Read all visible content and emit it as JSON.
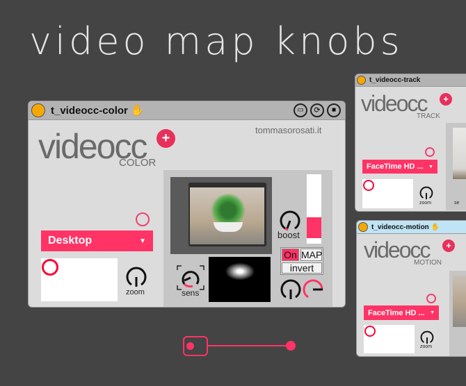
{
  "page": {
    "title": "video map knobs"
  },
  "color_device": {
    "title": "t_videocc-color",
    "logo": "videocc",
    "logo_plus": "+",
    "subtitle": "COLOR",
    "credit": "tommasorosati.it",
    "source_menu": "Desktop",
    "zoom_label": "zoom",
    "sens_label": "sens",
    "boost_label": "boost",
    "on_label": "On",
    "map_label": "MAP",
    "invert_label": "invert",
    "boost_level_percent": 30,
    "icons": [
      "hand-icon",
      "freeze-icon",
      "reload-icon",
      "save-icon"
    ]
  },
  "track_device": {
    "title": "t_videocc-track",
    "logo": "videocc",
    "logo_plus": "+",
    "subtitle": "TRACK",
    "source_menu": "FaceTime HD ...",
    "zoom_label": "zoom",
    "sens_label": "se"
  },
  "motion_device": {
    "title": "t_videocc-motion",
    "logo": "videocc",
    "logo_plus": "+",
    "subtitle": "MOTION",
    "source_menu": "FaceTime HD ...",
    "zoom_label": "zoom"
  },
  "colors": {
    "accent": "#ff3366",
    "background": "#444444",
    "panel": "#dcdcdc",
    "title_bar": "#b3b3b3",
    "selected_title_bar": "#bfe4f5"
  }
}
